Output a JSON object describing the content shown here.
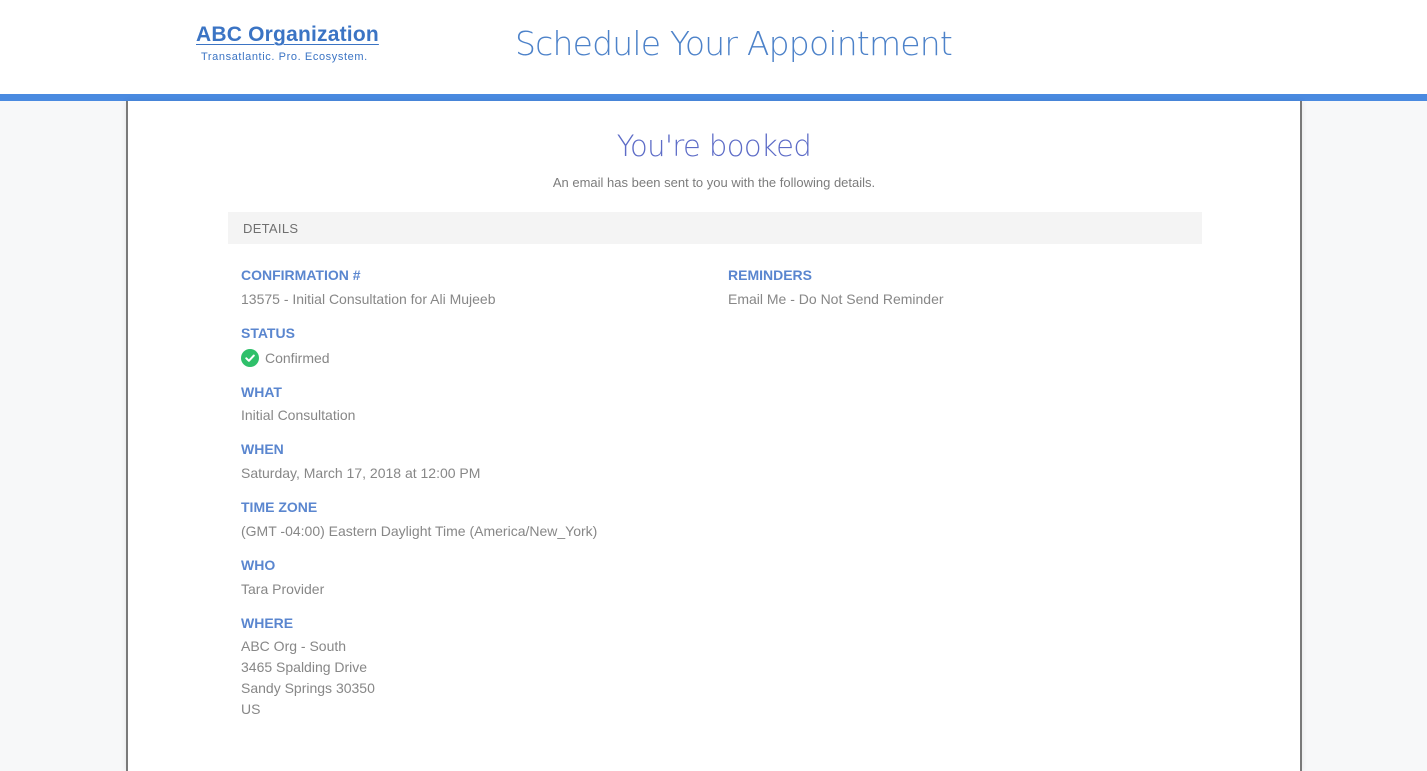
{
  "header": {
    "org_name": "ABC Organization",
    "org_tagline": "Transatlantic. Pro. Ecosystem.",
    "page_title": "Schedule Your Appointment"
  },
  "colors": {
    "accent": "#4a8ae0",
    "label": "#5a86cf",
    "status_confirmed": "#2fc06a"
  },
  "confirmation": {
    "title": "You're booked",
    "subtitle": "An email has been sent to you with the following details."
  },
  "details": {
    "section_label": "DETAILS",
    "confirmation_label": "CONFIRMATION #",
    "confirmation_value": "13575 - Initial Consultation for Ali Mujeeb",
    "status_label": "STATUS",
    "status_icon": "check-circle-icon",
    "status_value": "Confirmed",
    "what_label": "WHAT",
    "what_value": "Initial Consultation",
    "when_label": "WHEN",
    "when_value": "Saturday, March 17, 2018 at 12:00 PM",
    "timezone_label": "TIME ZONE",
    "timezone_value": "(GMT -04:00) Eastern Daylight Time (America/New_York)",
    "who_label": "WHO",
    "who_value": "Tara Provider",
    "where_label": "WHERE",
    "where_lines": [
      "ABC Org - South",
      "3465 Spalding Drive",
      "Sandy Springs 30350",
      "US"
    ],
    "reminders_label": "REMINDERS",
    "reminders_value": "Email Me - Do Not Send Reminder"
  }
}
